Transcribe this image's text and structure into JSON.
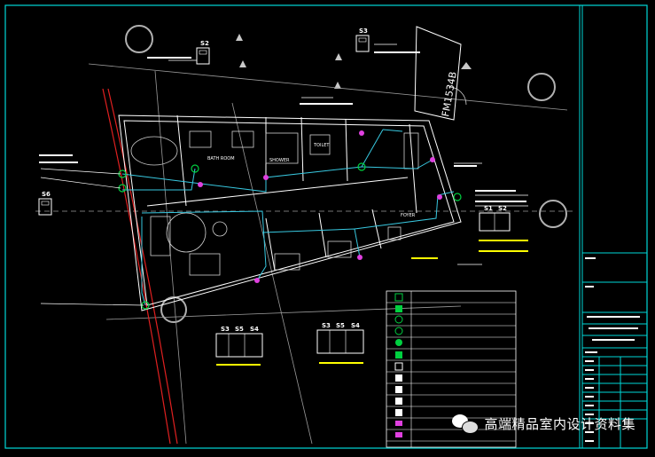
{
  "drawing": {
    "room_labels": {
      "bathroom": "BATH ROOM",
      "shower": "SHOWER",
      "toilet": "TOILET",
      "foyer": "FOYER"
    },
    "door_tag": "FM1534B",
    "switch_groups": [
      {
        "labels": [
          "S2"
        ]
      },
      {
        "labels": [
          "S3"
        ]
      },
      {
        "labels": [
          "S6"
        ]
      },
      {
        "labels": [
          "S1",
          "S2"
        ]
      },
      {
        "labels": [
          "S3",
          "S5",
          "S4"
        ]
      },
      {
        "labels": [
          "S3",
          "S5",
          "S4"
        ]
      }
    ]
  },
  "watermark": {
    "text": "高端精品室内设计资料集",
    "logo_icon": "wechat-icon"
  },
  "colors": {
    "frame": "#00d8d8",
    "walls": "#ffffff",
    "circuits": "#38c8e0",
    "highlight": "#e040e0",
    "annotation": "#ffff00",
    "fixtures": "#00d040",
    "boundary": "#e02020"
  }
}
